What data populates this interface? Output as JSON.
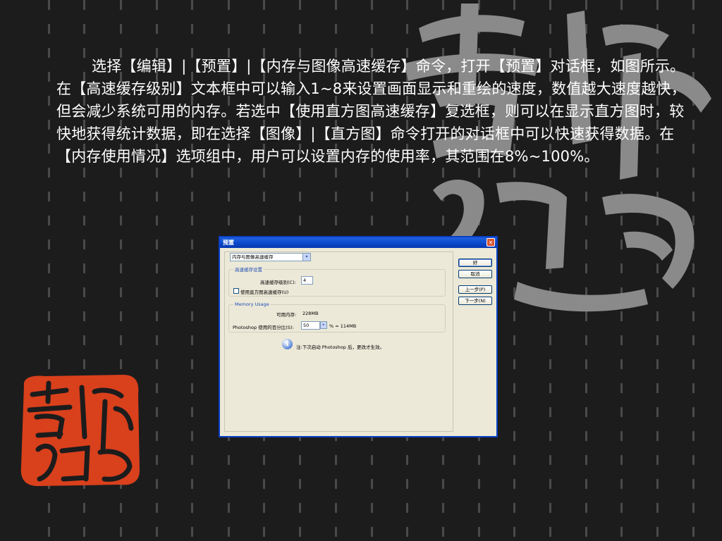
{
  "body_text": "选择【编辑】|【预置】|【内存与图像高速缓存】命令，打开【预置】对话框，如图所示。在【高速缓存级别】文本框中可以输入1~8来设置画面显示和重绘的速度，数值越大速度越快，但会减少系统可用的内存。若选中【使用直方图高速缓存】复选框，则可以在显示直方图时，较快地获得统计数据，即在选择【图像】|【直方图】命令打开的对话框中可以快速获得数据。在【内存使用情况】选项组中，用户可以设置内存的使用率，其范围在8%~100%。",
  "dialog": {
    "title": "预置",
    "close_glyph": "✕",
    "category_select": "内存与图像高速缓存",
    "cache_group": {
      "title": "高速缓存设置",
      "level_label": "高速缓存级别(C):",
      "level_value": "4",
      "histogram_label": "使用直方图高速缓存(U)",
      "histogram_checked": false
    },
    "memory_group": {
      "title": "Memory Usage",
      "available_label": "可用内存:",
      "available_value": "228MB",
      "percent_label": "Photoshop 使用的百分比(S):",
      "percent_value": "50",
      "percent_result": "% = 114MB"
    },
    "note": "注:下次启动 Photoshop 后，更改才生效。",
    "buttons": {
      "ok": "好",
      "cancel": "取消",
      "prev": "上一步(P)",
      "next": "下一步(N)"
    }
  },
  "icons": {
    "dropdown": "chevron-down-icon",
    "info": "info-icon",
    "close": "close-icon"
  }
}
